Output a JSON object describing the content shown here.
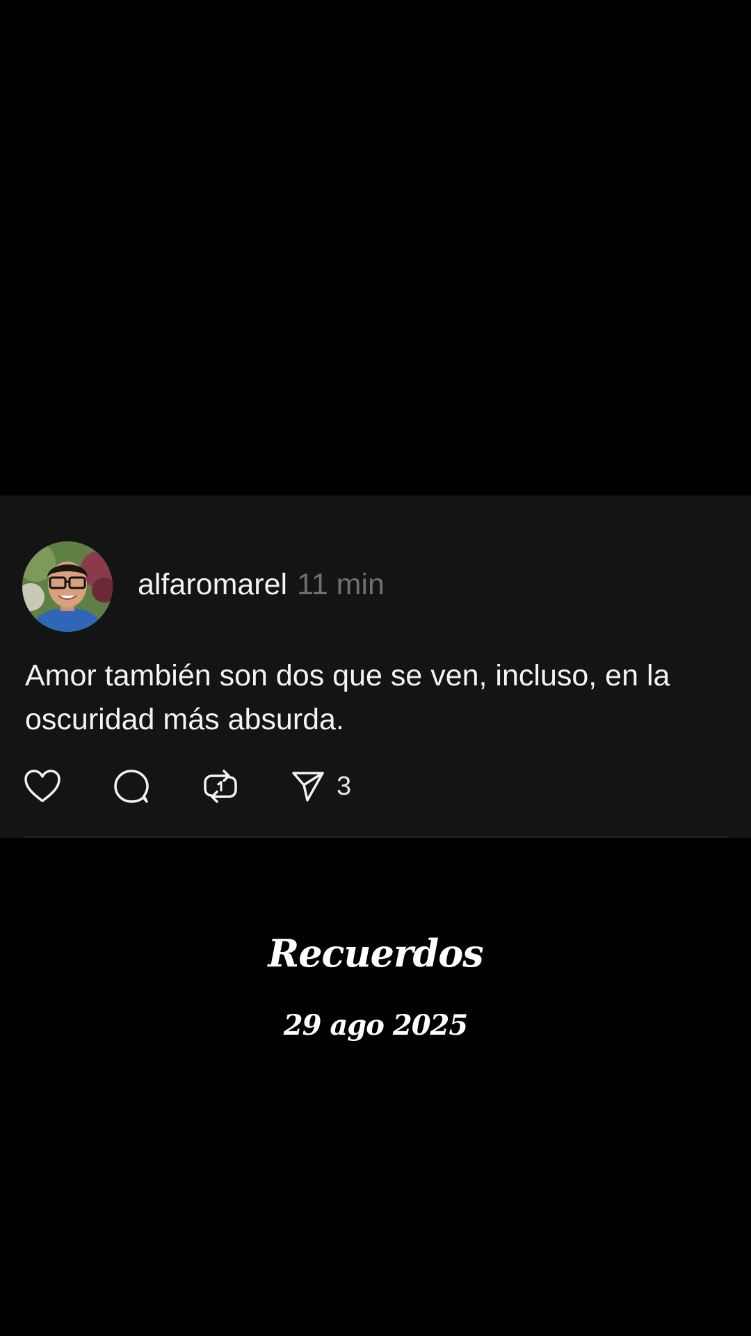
{
  "post": {
    "username": "alfaromarel",
    "timestamp": "11 min",
    "text": "Amor también son dos que se ven, incluso, en la oscuridad más absurda.",
    "avatar_icon": "profile-photo",
    "actions": {
      "like_icon": "heart-icon",
      "comment_icon": "comment-icon",
      "repost_icon": "repost-icon",
      "share_icon": "send-icon",
      "share_count": "3"
    }
  },
  "memories": {
    "title": "Recuerdos",
    "date": "29 ago 2025"
  },
  "colors": {
    "background": "#000000",
    "card_background": "#141414",
    "primary_text": "#f3f3f3",
    "secondary_text": "#6f6f6f"
  }
}
